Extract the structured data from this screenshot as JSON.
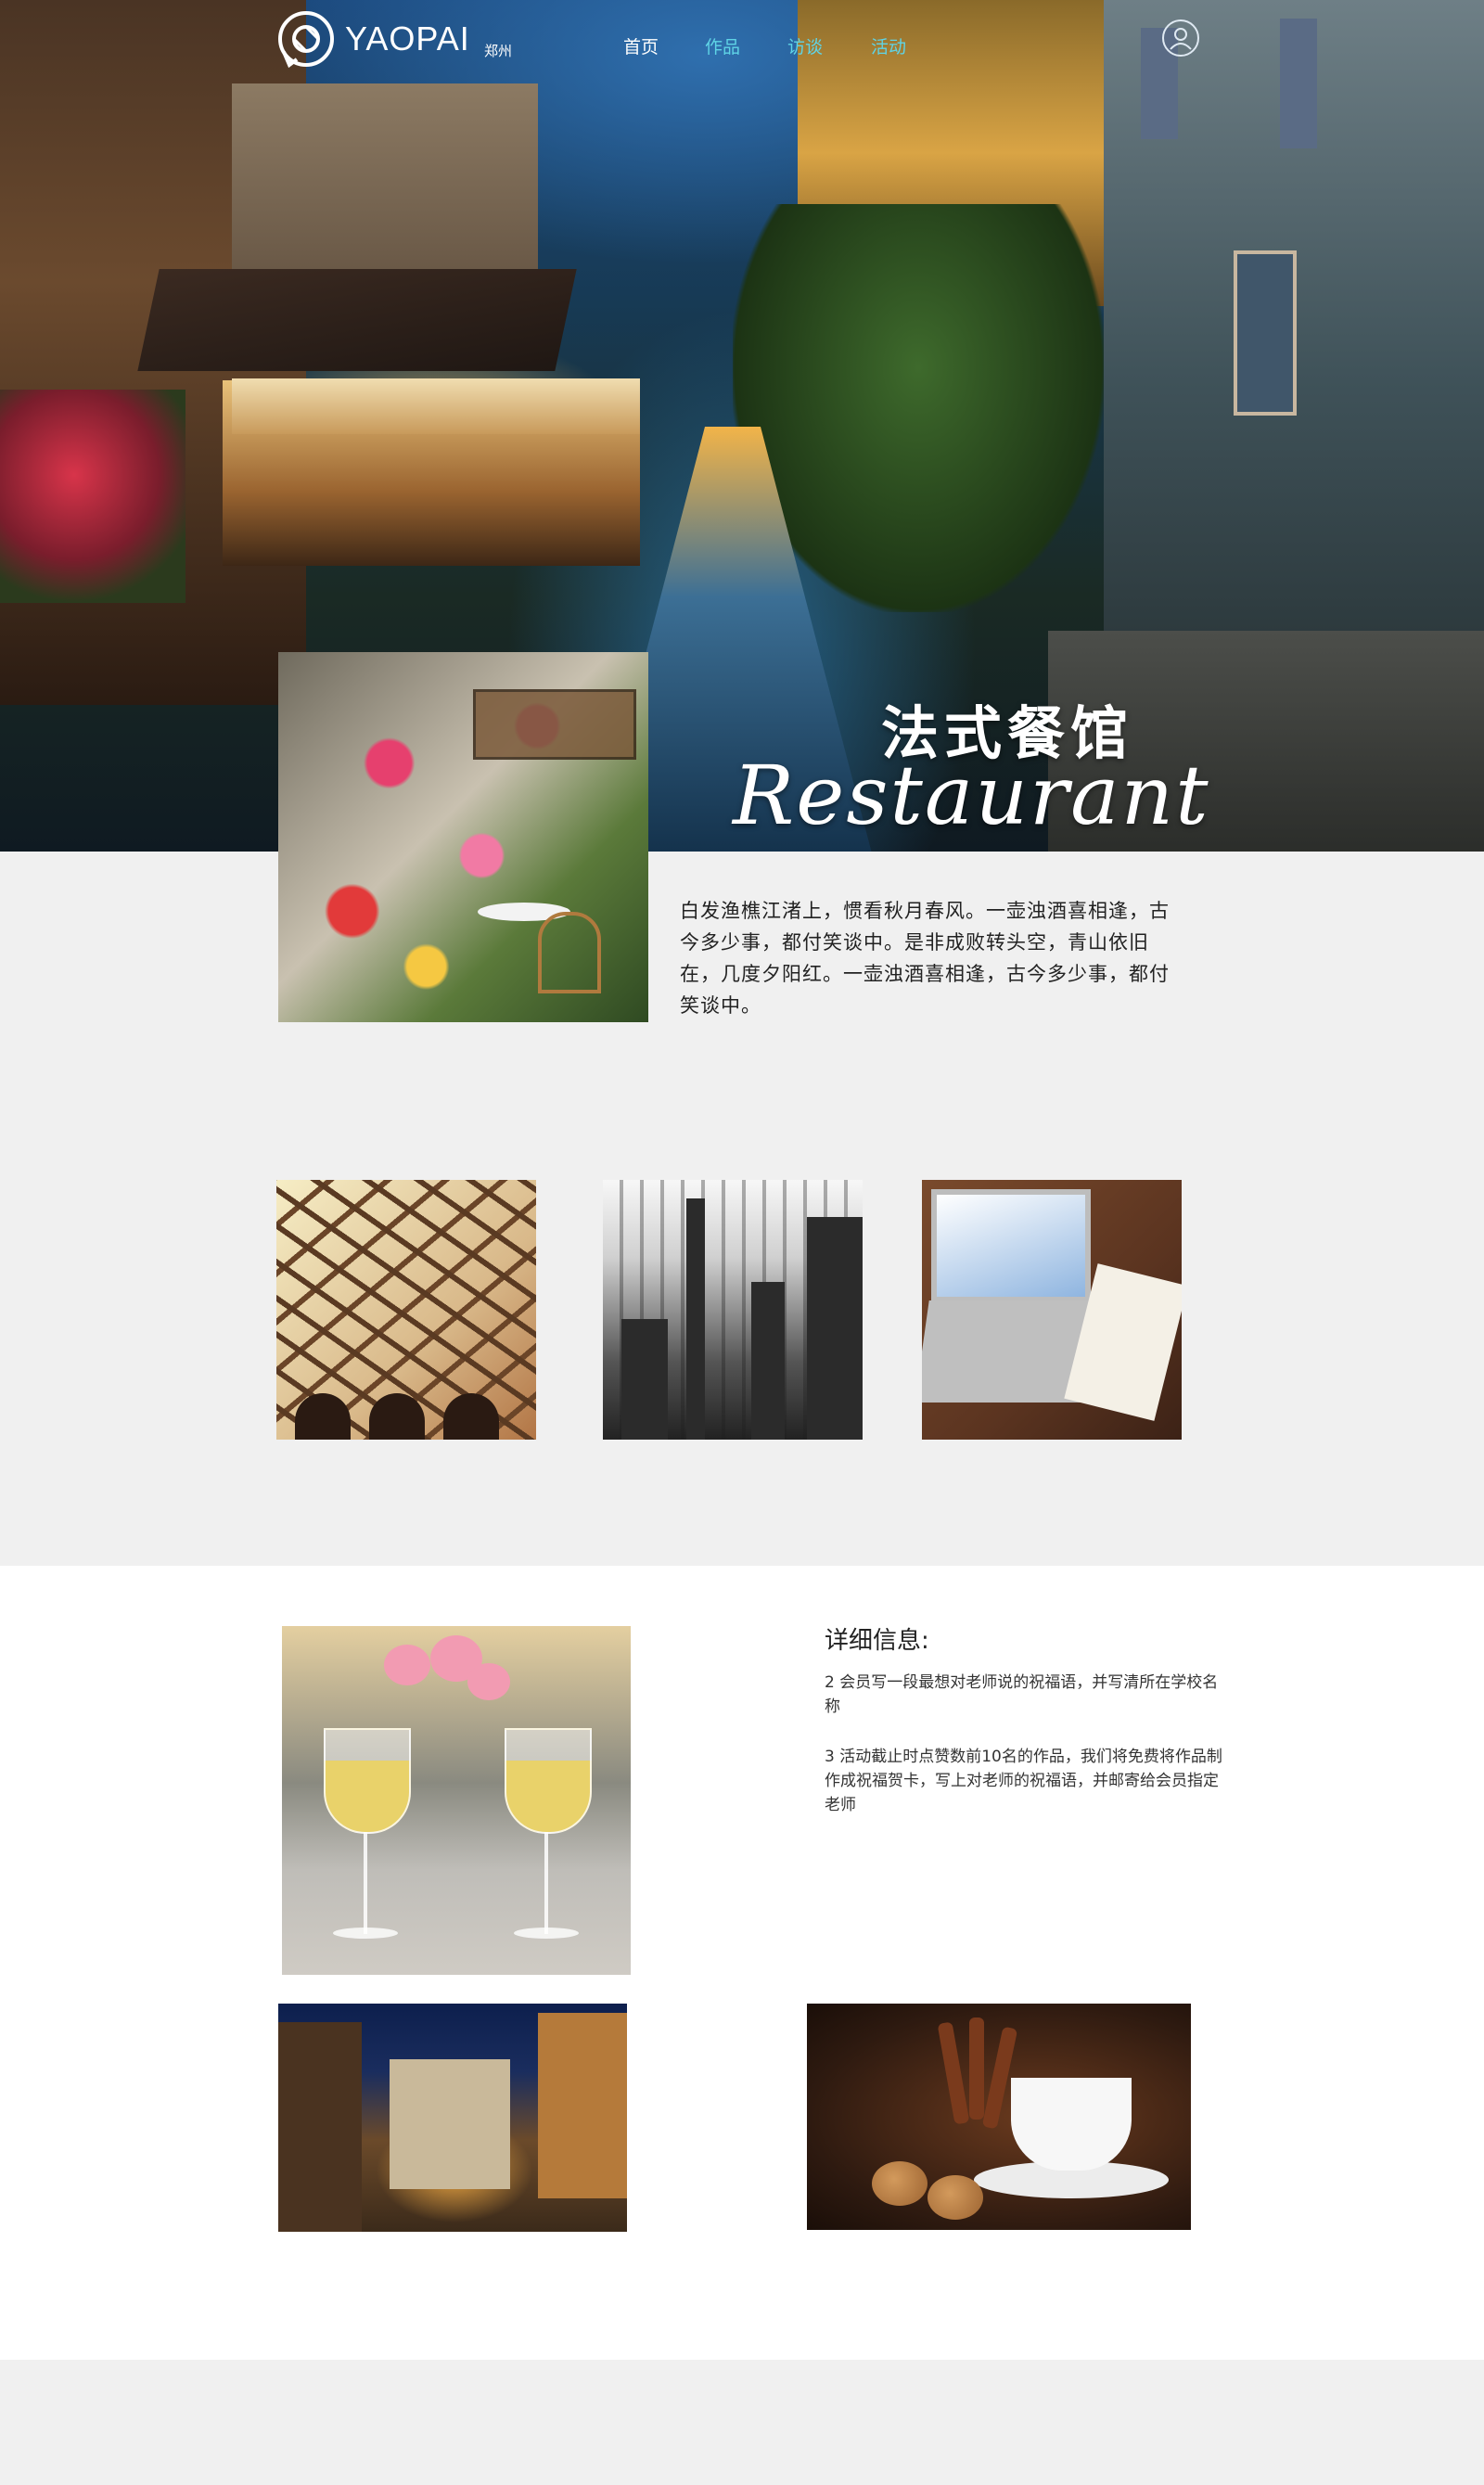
{
  "header": {
    "logo_text": "YAOPAI",
    "city": "郑州",
    "nav": [
      {
        "label": "首页"
      },
      {
        "label": "作品"
      },
      {
        "label": "访谈"
      },
      {
        "label": "活动"
      }
    ]
  },
  "hero": {
    "title_cn": "法式餐馆",
    "title_en": "Restaurant"
  },
  "intro": {
    "text": "白发渔樵江渚上，惯看秋月春风。一壶浊酒喜相逢，古今多少事，都付笑谈中。是非成败转头空，青山依旧在，几度夕阳红。一壶浊酒喜相逢，古今多少事，都付笑谈中。"
  },
  "details": {
    "title": "详细信息:",
    "paragraphs": [
      "2  会员写一段最想对老师说的祝福语，并写清所在学校名称",
      "3    活动截止时点赞数前10名的作品，我们将免费将作品制作成祝福贺卡，写上对老师的祝福语，并邮寄给会员指定老师"
    ]
  },
  "colors": {
    "nav_active": "#ffffff",
    "nav_link": "#5fd4e6",
    "page_bg": "#f0f0f0",
    "section_bg": "#ffffff"
  }
}
